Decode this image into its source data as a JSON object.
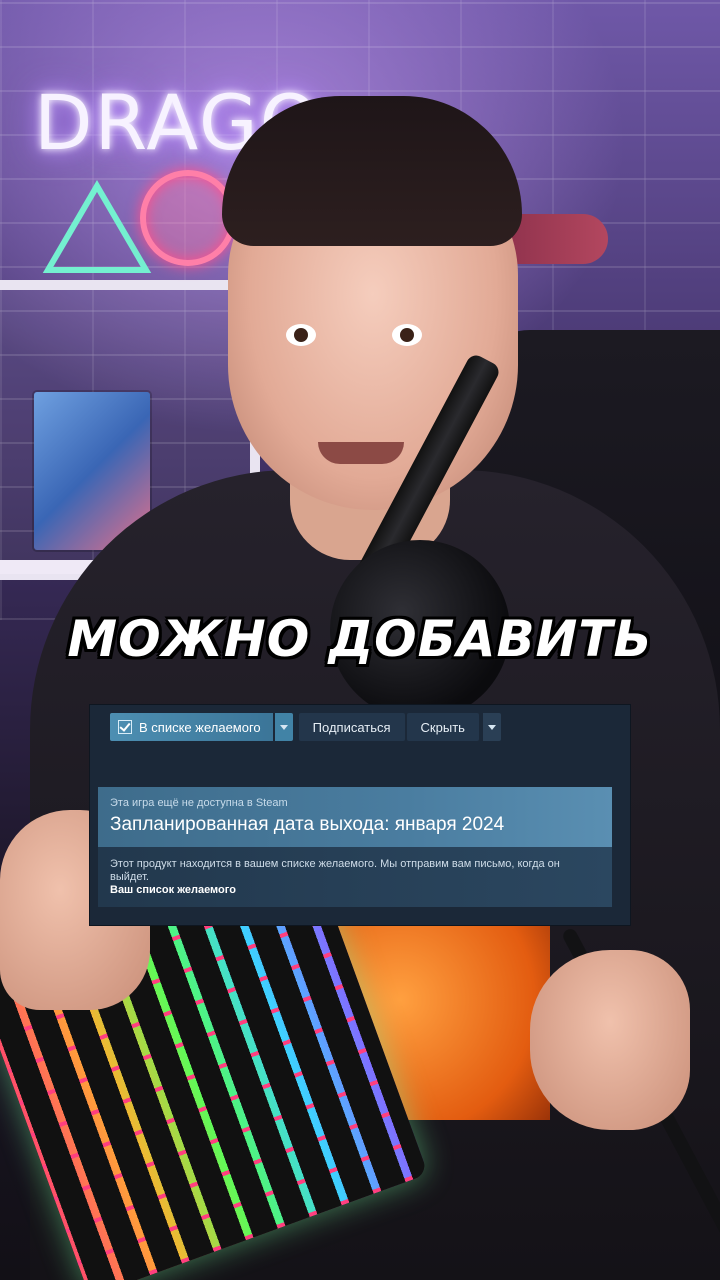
{
  "scene": {
    "neon_sign_text": "DRAGO"
  },
  "caption": {
    "text": "МОЖНО ДОБАВИТЬ"
  },
  "steam": {
    "toolbar": {
      "wishlist_button_label": "В списке желаемого",
      "follow_button_label": "Подписаться",
      "ignore_button_label": "Скрыть"
    },
    "notice": {
      "subtitle": "Эта игра ещё не доступна в Steam",
      "release_line": "Запланированная дата выхода: января 2024"
    },
    "info": {
      "text": "Этот продукт находится в вашем списке желаемого. Мы отправим вам письмо, когда он выйдет.",
      "link_label": "Ваш список желаемого"
    },
    "colors": {
      "panel_bg": "#1b2838",
      "wishlist_button": "#4d8fb2",
      "notice_bg": "#4a7da0"
    }
  }
}
